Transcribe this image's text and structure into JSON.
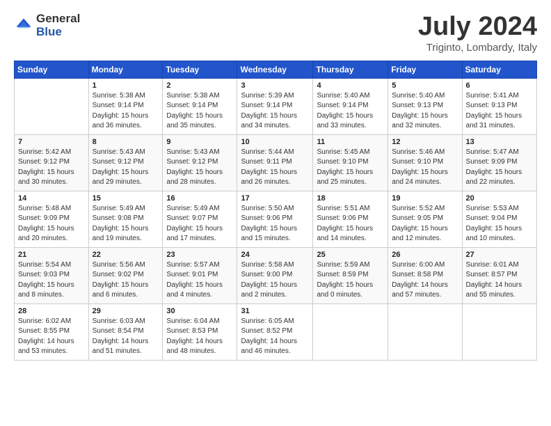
{
  "header": {
    "logo_general": "General",
    "logo_blue": "Blue",
    "title": "July 2024",
    "subtitle": "Triginto, Lombardy, Italy"
  },
  "calendar": {
    "days_of_week": [
      "Sunday",
      "Monday",
      "Tuesday",
      "Wednesday",
      "Thursday",
      "Friday",
      "Saturday"
    ],
    "weeks": [
      [
        {
          "day": "",
          "info": ""
        },
        {
          "day": "1",
          "info": "Sunrise: 5:38 AM\nSunset: 9:14 PM\nDaylight: 15 hours\nand 36 minutes."
        },
        {
          "day": "2",
          "info": "Sunrise: 5:38 AM\nSunset: 9:14 PM\nDaylight: 15 hours\nand 35 minutes."
        },
        {
          "day": "3",
          "info": "Sunrise: 5:39 AM\nSunset: 9:14 PM\nDaylight: 15 hours\nand 34 minutes."
        },
        {
          "day": "4",
          "info": "Sunrise: 5:40 AM\nSunset: 9:14 PM\nDaylight: 15 hours\nand 33 minutes."
        },
        {
          "day": "5",
          "info": "Sunrise: 5:40 AM\nSunset: 9:13 PM\nDaylight: 15 hours\nand 32 minutes."
        },
        {
          "day": "6",
          "info": "Sunrise: 5:41 AM\nSunset: 9:13 PM\nDaylight: 15 hours\nand 31 minutes."
        }
      ],
      [
        {
          "day": "7",
          "info": "Sunrise: 5:42 AM\nSunset: 9:12 PM\nDaylight: 15 hours\nand 30 minutes."
        },
        {
          "day": "8",
          "info": "Sunrise: 5:43 AM\nSunset: 9:12 PM\nDaylight: 15 hours\nand 29 minutes."
        },
        {
          "day": "9",
          "info": "Sunrise: 5:43 AM\nSunset: 9:12 PM\nDaylight: 15 hours\nand 28 minutes."
        },
        {
          "day": "10",
          "info": "Sunrise: 5:44 AM\nSunset: 9:11 PM\nDaylight: 15 hours\nand 26 minutes."
        },
        {
          "day": "11",
          "info": "Sunrise: 5:45 AM\nSunset: 9:10 PM\nDaylight: 15 hours\nand 25 minutes."
        },
        {
          "day": "12",
          "info": "Sunrise: 5:46 AM\nSunset: 9:10 PM\nDaylight: 15 hours\nand 24 minutes."
        },
        {
          "day": "13",
          "info": "Sunrise: 5:47 AM\nSunset: 9:09 PM\nDaylight: 15 hours\nand 22 minutes."
        }
      ],
      [
        {
          "day": "14",
          "info": "Sunrise: 5:48 AM\nSunset: 9:09 PM\nDaylight: 15 hours\nand 20 minutes."
        },
        {
          "day": "15",
          "info": "Sunrise: 5:49 AM\nSunset: 9:08 PM\nDaylight: 15 hours\nand 19 minutes."
        },
        {
          "day": "16",
          "info": "Sunrise: 5:49 AM\nSunset: 9:07 PM\nDaylight: 15 hours\nand 17 minutes."
        },
        {
          "day": "17",
          "info": "Sunrise: 5:50 AM\nSunset: 9:06 PM\nDaylight: 15 hours\nand 15 minutes."
        },
        {
          "day": "18",
          "info": "Sunrise: 5:51 AM\nSunset: 9:06 PM\nDaylight: 15 hours\nand 14 minutes."
        },
        {
          "day": "19",
          "info": "Sunrise: 5:52 AM\nSunset: 9:05 PM\nDaylight: 15 hours\nand 12 minutes."
        },
        {
          "day": "20",
          "info": "Sunrise: 5:53 AM\nSunset: 9:04 PM\nDaylight: 15 hours\nand 10 minutes."
        }
      ],
      [
        {
          "day": "21",
          "info": "Sunrise: 5:54 AM\nSunset: 9:03 PM\nDaylight: 15 hours\nand 8 minutes."
        },
        {
          "day": "22",
          "info": "Sunrise: 5:56 AM\nSunset: 9:02 PM\nDaylight: 15 hours\nand 6 minutes."
        },
        {
          "day": "23",
          "info": "Sunrise: 5:57 AM\nSunset: 9:01 PM\nDaylight: 15 hours\nand 4 minutes."
        },
        {
          "day": "24",
          "info": "Sunrise: 5:58 AM\nSunset: 9:00 PM\nDaylight: 15 hours\nand 2 minutes."
        },
        {
          "day": "25",
          "info": "Sunrise: 5:59 AM\nSunset: 8:59 PM\nDaylight: 15 hours\nand 0 minutes."
        },
        {
          "day": "26",
          "info": "Sunrise: 6:00 AM\nSunset: 8:58 PM\nDaylight: 14 hours\nand 57 minutes."
        },
        {
          "day": "27",
          "info": "Sunrise: 6:01 AM\nSunset: 8:57 PM\nDaylight: 14 hours\nand 55 minutes."
        }
      ],
      [
        {
          "day": "28",
          "info": "Sunrise: 6:02 AM\nSunset: 8:55 PM\nDaylight: 14 hours\nand 53 minutes."
        },
        {
          "day": "29",
          "info": "Sunrise: 6:03 AM\nSunset: 8:54 PM\nDaylight: 14 hours\nand 51 minutes."
        },
        {
          "day": "30",
          "info": "Sunrise: 6:04 AM\nSunset: 8:53 PM\nDaylight: 14 hours\nand 48 minutes."
        },
        {
          "day": "31",
          "info": "Sunrise: 6:05 AM\nSunset: 8:52 PM\nDaylight: 14 hours\nand 46 minutes."
        },
        {
          "day": "",
          "info": ""
        },
        {
          "day": "",
          "info": ""
        },
        {
          "day": "",
          "info": ""
        }
      ]
    ]
  }
}
